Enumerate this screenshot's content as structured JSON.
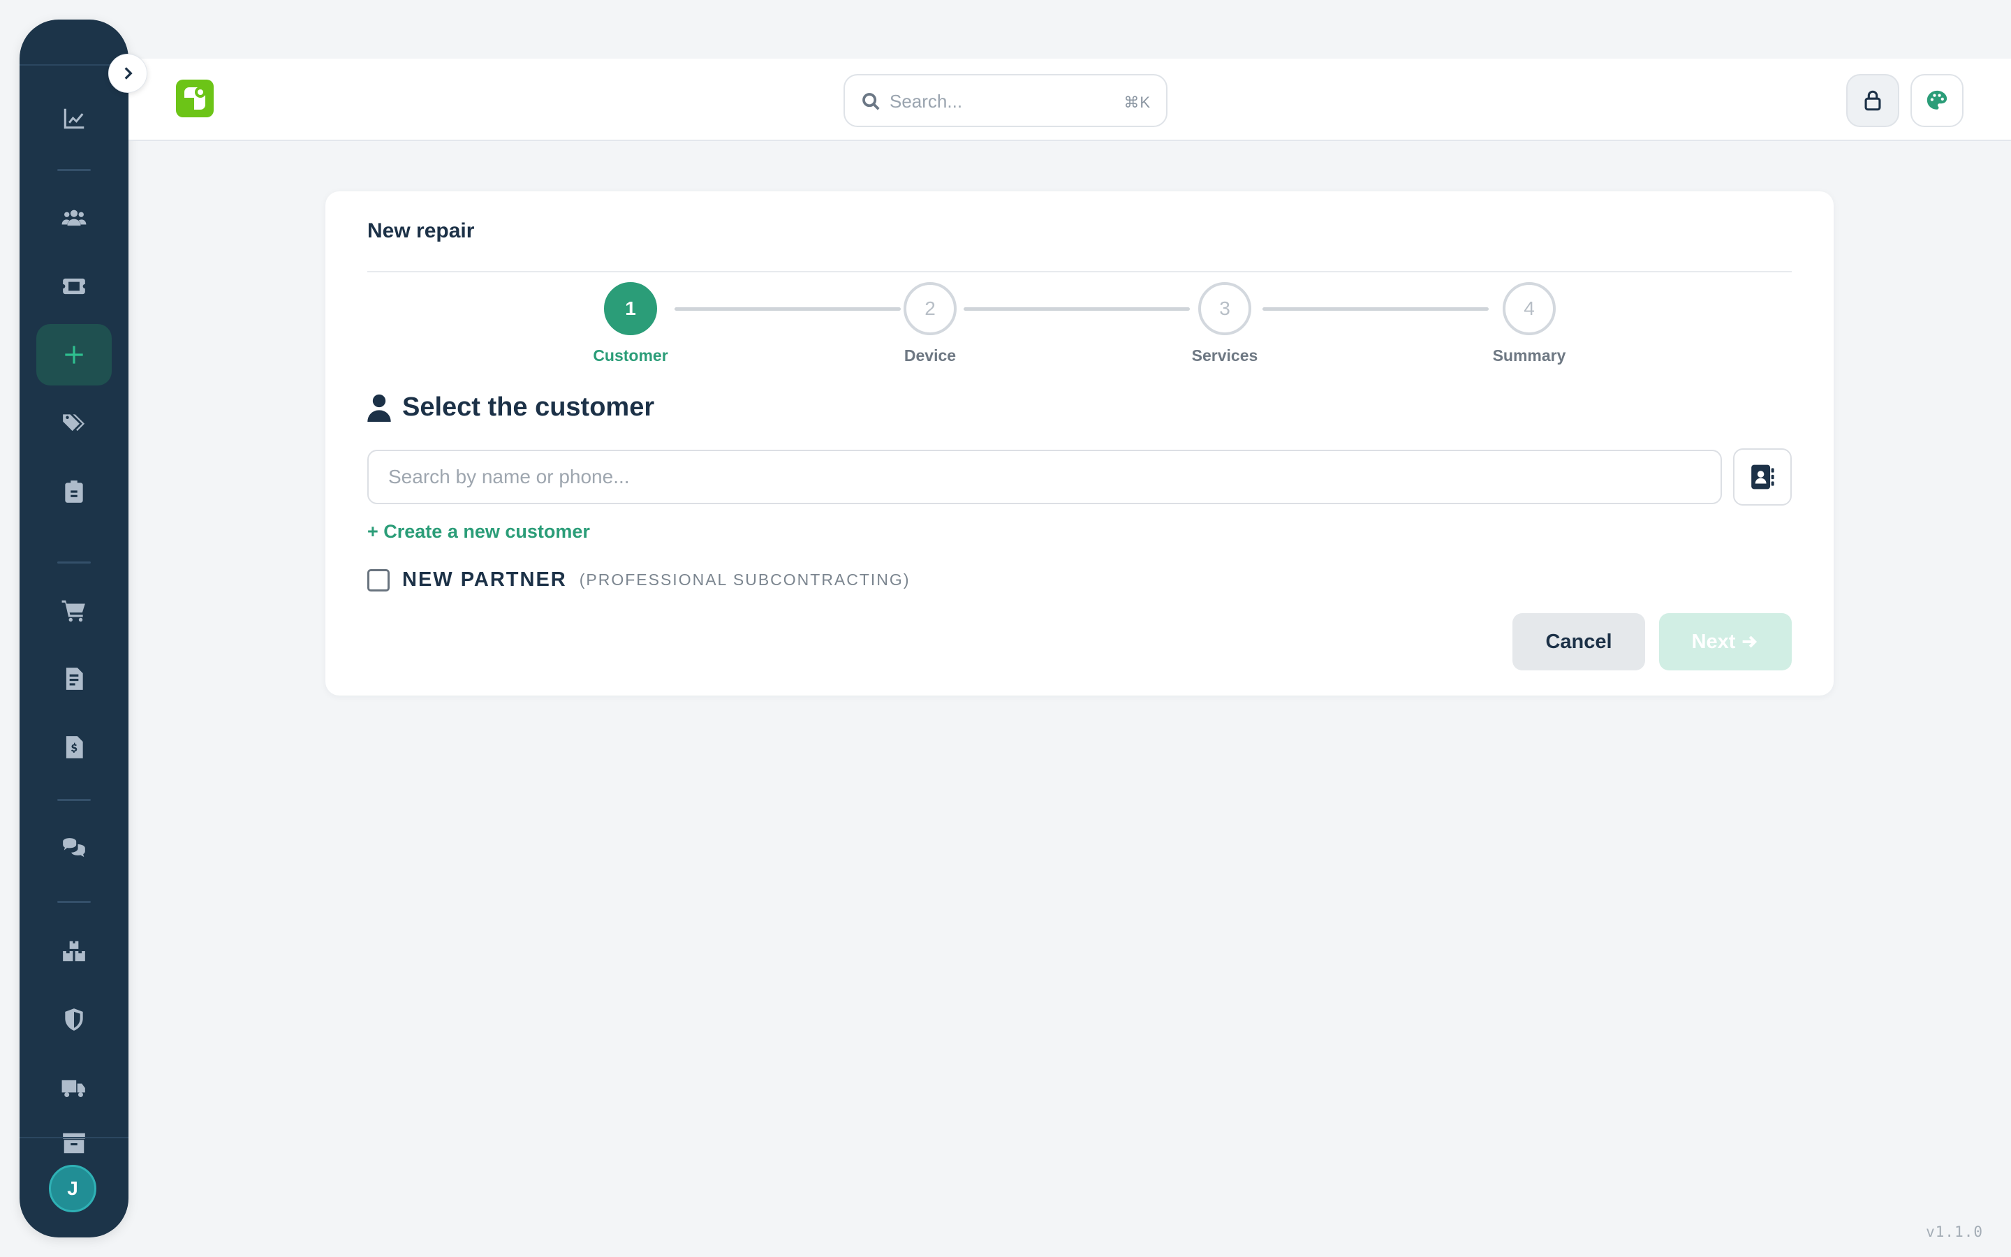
{
  "header": {
    "search_placeholder": "Search...",
    "search_shortcut": "⌘K"
  },
  "sidebar": {
    "items": [
      {
        "icon": "chart-line-icon"
      },
      {
        "icon": "users-icon"
      },
      {
        "icon": "ticket-icon"
      },
      {
        "icon": "plus-icon",
        "active": true
      },
      {
        "icon": "tags-icon"
      },
      {
        "icon": "clipboard-icon"
      },
      {
        "icon": "cart-icon"
      },
      {
        "icon": "file-invoice-icon"
      },
      {
        "icon": "file-dollar-icon"
      },
      {
        "icon": "comments-icon"
      },
      {
        "icon": "boxes-icon"
      },
      {
        "icon": "shield-icon"
      },
      {
        "icon": "truck-icon"
      },
      {
        "icon": "archive-icon"
      }
    ],
    "avatar_initial": "J"
  },
  "card": {
    "title": "New repair",
    "steps": [
      {
        "number": "1",
        "label": "Customer",
        "active": true
      },
      {
        "number": "2",
        "label": "Device",
        "active": false
      },
      {
        "number": "3",
        "label": "Services",
        "active": false
      },
      {
        "number": "4",
        "label": "Summary",
        "active": false
      }
    ],
    "section_title": "Select the customer",
    "search_placeholder": "Search by name or phone...",
    "create_link": "+ Create a new customer",
    "partner_label": "NEW PARTNER",
    "partner_sub": "(PROFESSIONAL SUBCONTRACTING)",
    "cancel_label": "Cancel",
    "next_label": "Next"
  },
  "colors": {
    "accent": "#2b9d78",
    "sidebar_bg": "#1c3449",
    "logo_green": "#6cc417"
  },
  "version": "v1.1.0"
}
